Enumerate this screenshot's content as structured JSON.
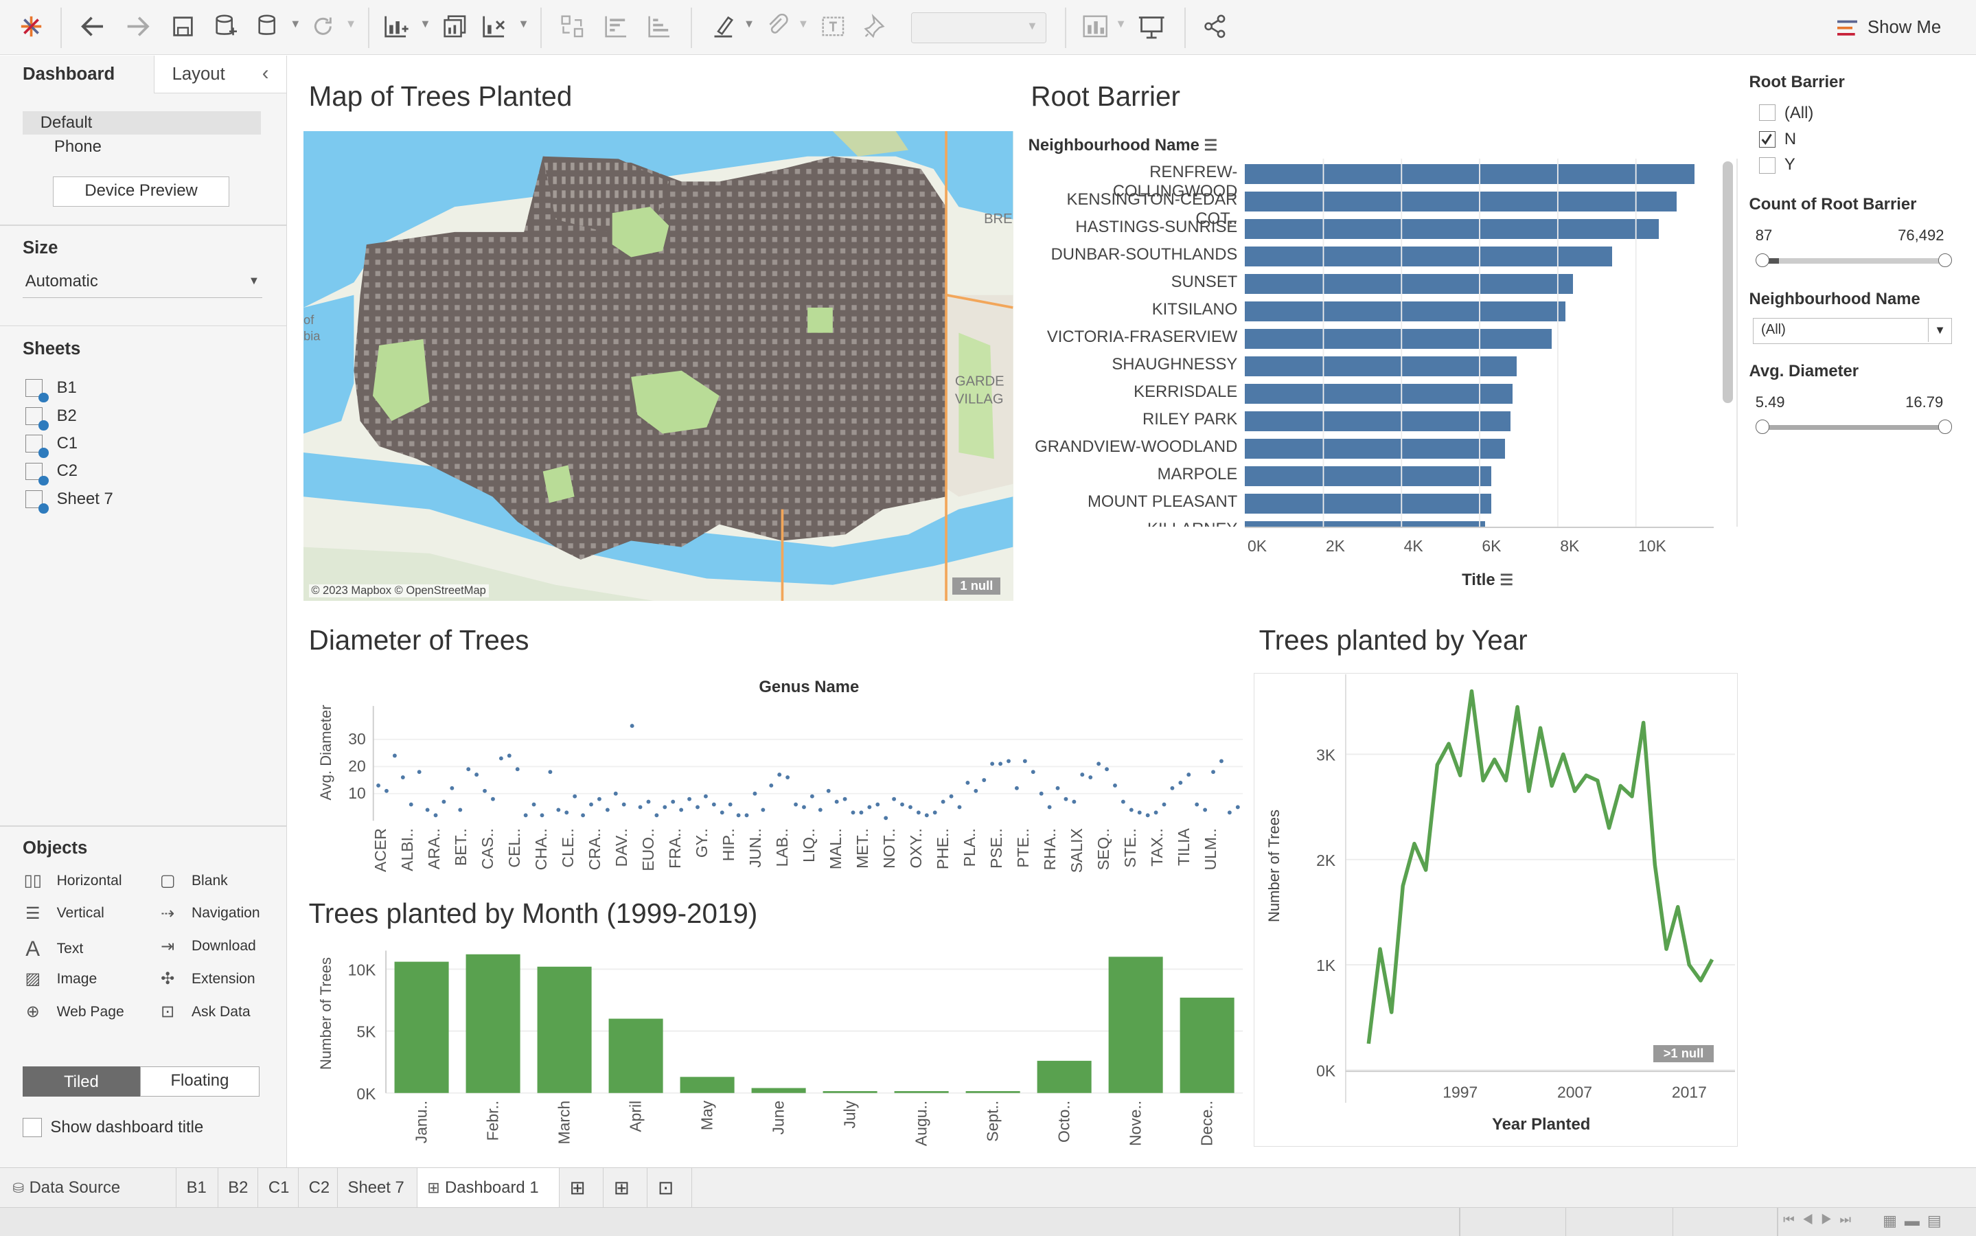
{
  "toolbar": {
    "show_me": "Show Me",
    "icons": [
      "tableau-logo-icon",
      "undo-icon",
      "redo-icon",
      "save-icon",
      "new-datasource-icon",
      "pause-icon",
      "refresh-icon",
      "new-worksheet-icon",
      "duplicate-icon",
      "clear-icon",
      "swap-icon",
      "sort-asc-icon",
      "sort-desc-icon",
      "highlight-icon",
      "group-icon",
      "labels-icon",
      "fix-axes-icon",
      "present-icon",
      "share-icon"
    ]
  },
  "left_panel": {
    "tabs": [
      "Dashboard",
      "Layout"
    ],
    "device_options": [
      "Default",
      "Phone"
    ],
    "device_preview": "Device Preview",
    "size_heading": "Size",
    "size_value": "Automatic",
    "sheets_heading": "Sheets",
    "sheets": [
      "B1",
      "B2",
      "C1",
      "C2",
      "Sheet 7"
    ],
    "objects_heading": "Objects",
    "objects": [
      {
        "label": "Horizontal",
        "icon": "horizontal-container-icon"
      },
      {
        "label": "Blank",
        "icon": "blank-icon"
      },
      {
        "label": "Vertical",
        "icon": "vertical-container-icon"
      },
      {
        "label": "Navigation",
        "icon": "navigation-icon"
      },
      {
        "label": "Text",
        "icon": "text-icon"
      },
      {
        "label": "Download",
        "icon": "download-icon"
      },
      {
        "label": "Image",
        "icon": "image-icon"
      },
      {
        "label": "Extension",
        "icon": "extension-icon"
      },
      {
        "label": "Web Page",
        "icon": "web-page-icon"
      },
      {
        "label": "Ask Data",
        "icon": "ask-data-icon"
      }
    ],
    "tiled": "Tiled",
    "floating": "Floating",
    "show_title": "Show dashboard title"
  },
  "map": {
    "title": "Map of Trees Planted",
    "attribution": "© 2023 Mapbox © OpenStreetMap",
    "null_badge": "1 null"
  },
  "root_barrier": {
    "title": "Root Barrier",
    "header": "Neighbourhood Name",
    "axis_title": "Title"
  },
  "diameter": {
    "title": "Diameter of Trees",
    "header": "Genus Name",
    "ylabel": "Avg. Diameter"
  },
  "monthly": {
    "title": "Trees planted by Month (1999-2019)",
    "ylabel": "Number of Trees"
  },
  "yearly": {
    "title": "Trees planted by Year",
    "ylabel": "Number of Trees",
    "xlabel": "Year Planted",
    "null_badge": ">1 null"
  },
  "filters": {
    "root_barrier": {
      "title": "Root Barrier",
      "options": [
        {
          "label": "(All)",
          "checked": false
        },
        {
          "label": "N",
          "checked": true
        },
        {
          "label": "Y",
          "checked": false
        }
      ]
    },
    "count": {
      "title": "Count of Root Barrier",
      "min": "87",
      "max": "76,492",
      "fill": 0.1
    },
    "neighbourhood": {
      "title": "Neighbourhood Name",
      "value": "(All)"
    },
    "avg_diameter": {
      "title": "Avg. Diameter",
      "min": "5.49",
      "max": "16.79"
    }
  },
  "bottom_tabs": [
    "Data Source",
    "B1",
    "B2",
    "C1",
    "C2",
    "Sheet 7",
    "Dashboard 1"
  ],
  "colors": {
    "bar_blue": "#4e79a7",
    "green": "#59a14f",
    "map_street": "#6e6461",
    "water": "#7cc9ef"
  },
  "chart_data": [
    {
      "type": "bar",
      "orientation": "horizontal",
      "title": "Root Barrier",
      "ylabel": "Neighbourhood Name",
      "xlabel": "Title",
      "categories": [
        "RENFREW-COLLINGWOOD",
        "KENSINGTON-CEDAR COT..",
        "HASTINGS-SUNRISE",
        "DUNBAR-SOUTHLANDS",
        "SUNSET",
        "KITSILANO",
        "VICTORIA-FRASERVIEW",
        "SHAUGHNESSY",
        "KERRISDALE",
        "RILEY PARK",
        "GRANDVIEW-WOODLAND",
        "MARPOLE",
        "MOUNT PLEASANT",
        "KILLARNEY"
      ],
      "values": [
        11500,
        11050,
        10600,
        9400,
        8400,
        8200,
        7850,
        6950,
        6850,
        6800,
        6650,
        6300,
        6300,
        6150
      ],
      "xlim": [
        0,
        12000
      ],
      "xticks": [
        "0K",
        "2K",
        "4K",
        "6K",
        "8K",
        "10K"
      ]
    },
    {
      "type": "scatter",
      "title": "Diameter of Trees",
      "xlabel": "Genus Name",
      "ylabel": "Avg. Diameter",
      "ylim": [
        0,
        40
      ],
      "yticks": [
        "10",
        "20",
        "30"
      ],
      "categories_shown": [
        "ACER",
        "ALBI..",
        "ARA..",
        "BET..",
        "CAS..",
        "CEL..",
        "CHA..",
        "CLE..",
        "CRA..",
        "DAV..",
        "EUO..",
        "FRA..",
        "GY..",
        "HIP..",
        "JUN..",
        "LAB..",
        "LIQ..",
        "MAL..",
        "MET..",
        "NOT..",
        "OXY..",
        "PHE..",
        "PLA..",
        "PSE..",
        "PTE..",
        "RHA..",
        "SALIX",
        "SEQ..",
        "STE..",
        "TAX..",
        "TILIA",
        "ULM.."
      ],
      "values": [
        13,
        11,
        24,
        16,
        6,
        18,
        4,
        2,
        7,
        12,
        4,
        19,
        17,
        11,
        8,
        23,
        24,
        19,
        2,
        6,
        2,
        18,
        4,
        3,
        9,
        2,
        6,
        8,
        4,
        10,
        6,
        35,
        5,
        7,
        2,
        5,
        7,
        4,
        8,
        5,
        9,
        6,
        3,
        6,
        2,
        2,
        10,
        4,
        13,
        17,
        16,
        6,
        5,
        9,
        4,
        11,
        7,
        8,
        3,
        3,
        5,
        6,
        1,
        8,
        6,
        5,
        3,
        2,
        3,
        7,
        9,
        5,
        14,
        11,
        15,
        21,
        21,
        22,
        12,
        22,
        18,
        10,
        5,
        12,
        8,
        7,
        17,
        16,
        21,
        19,
        13,
        7,
        4,
        3,
        2,
        3,
        6,
        12,
        14,
        17,
        6,
        4,
        18,
        22,
        3,
        5
      ]
    },
    {
      "type": "bar",
      "title": "Trees planted by Month (1999-2019)",
      "ylabel": "Number of Trees",
      "categories": [
        "Janu..",
        "Febr..",
        "March",
        "April",
        "May",
        "June",
        "July",
        "Augu..",
        "Sept..",
        "Octo..",
        "Nove..",
        "Dece.."
      ],
      "values": [
        10600,
        11200,
        10200,
        6000,
        1300,
        400,
        150,
        150,
        150,
        2600,
        11000,
        7700
      ],
      "ylim": [
        0,
        11500
      ],
      "yticks": [
        "0K",
        "5K",
        "10K"
      ]
    },
    {
      "type": "line",
      "title": "Trees planted by Year",
      "xlabel": "Year Planted",
      "ylabel": "Number of Trees",
      "x": [
        1989,
        1990,
        1991,
        1992,
        1993,
        1994,
        1995,
        1996,
        1997,
        1998,
        1999,
        2000,
        2001,
        2002,
        2003,
        2004,
        2005,
        2006,
        2007,
        2008,
        2009,
        2010,
        2011,
        2012,
        2013,
        2014,
        2015,
        2016,
        2017,
        2018,
        2019
      ],
      "y": [
        250,
        1150,
        550,
        1750,
        2150,
        1900,
        2900,
        3100,
        2800,
        3600,
        2750,
        2950,
        2750,
        3450,
        2650,
        3250,
        2700,
        3000,
        2650,
        2800,
        2750,
        2300,
        2700,
        2600,
        3300,
        1950,
        1150,
        1550,
        1000,
        850,
        1050
      ],
      "ylim": [
        0,
        3700
      ],
      "yticks": [
        "0K",
        "1K",
        "2K",
        "3K"
      ],
      "xticks": [
        "1997",
        "2007",
        "2017"
      ]
    }
  ]
}
